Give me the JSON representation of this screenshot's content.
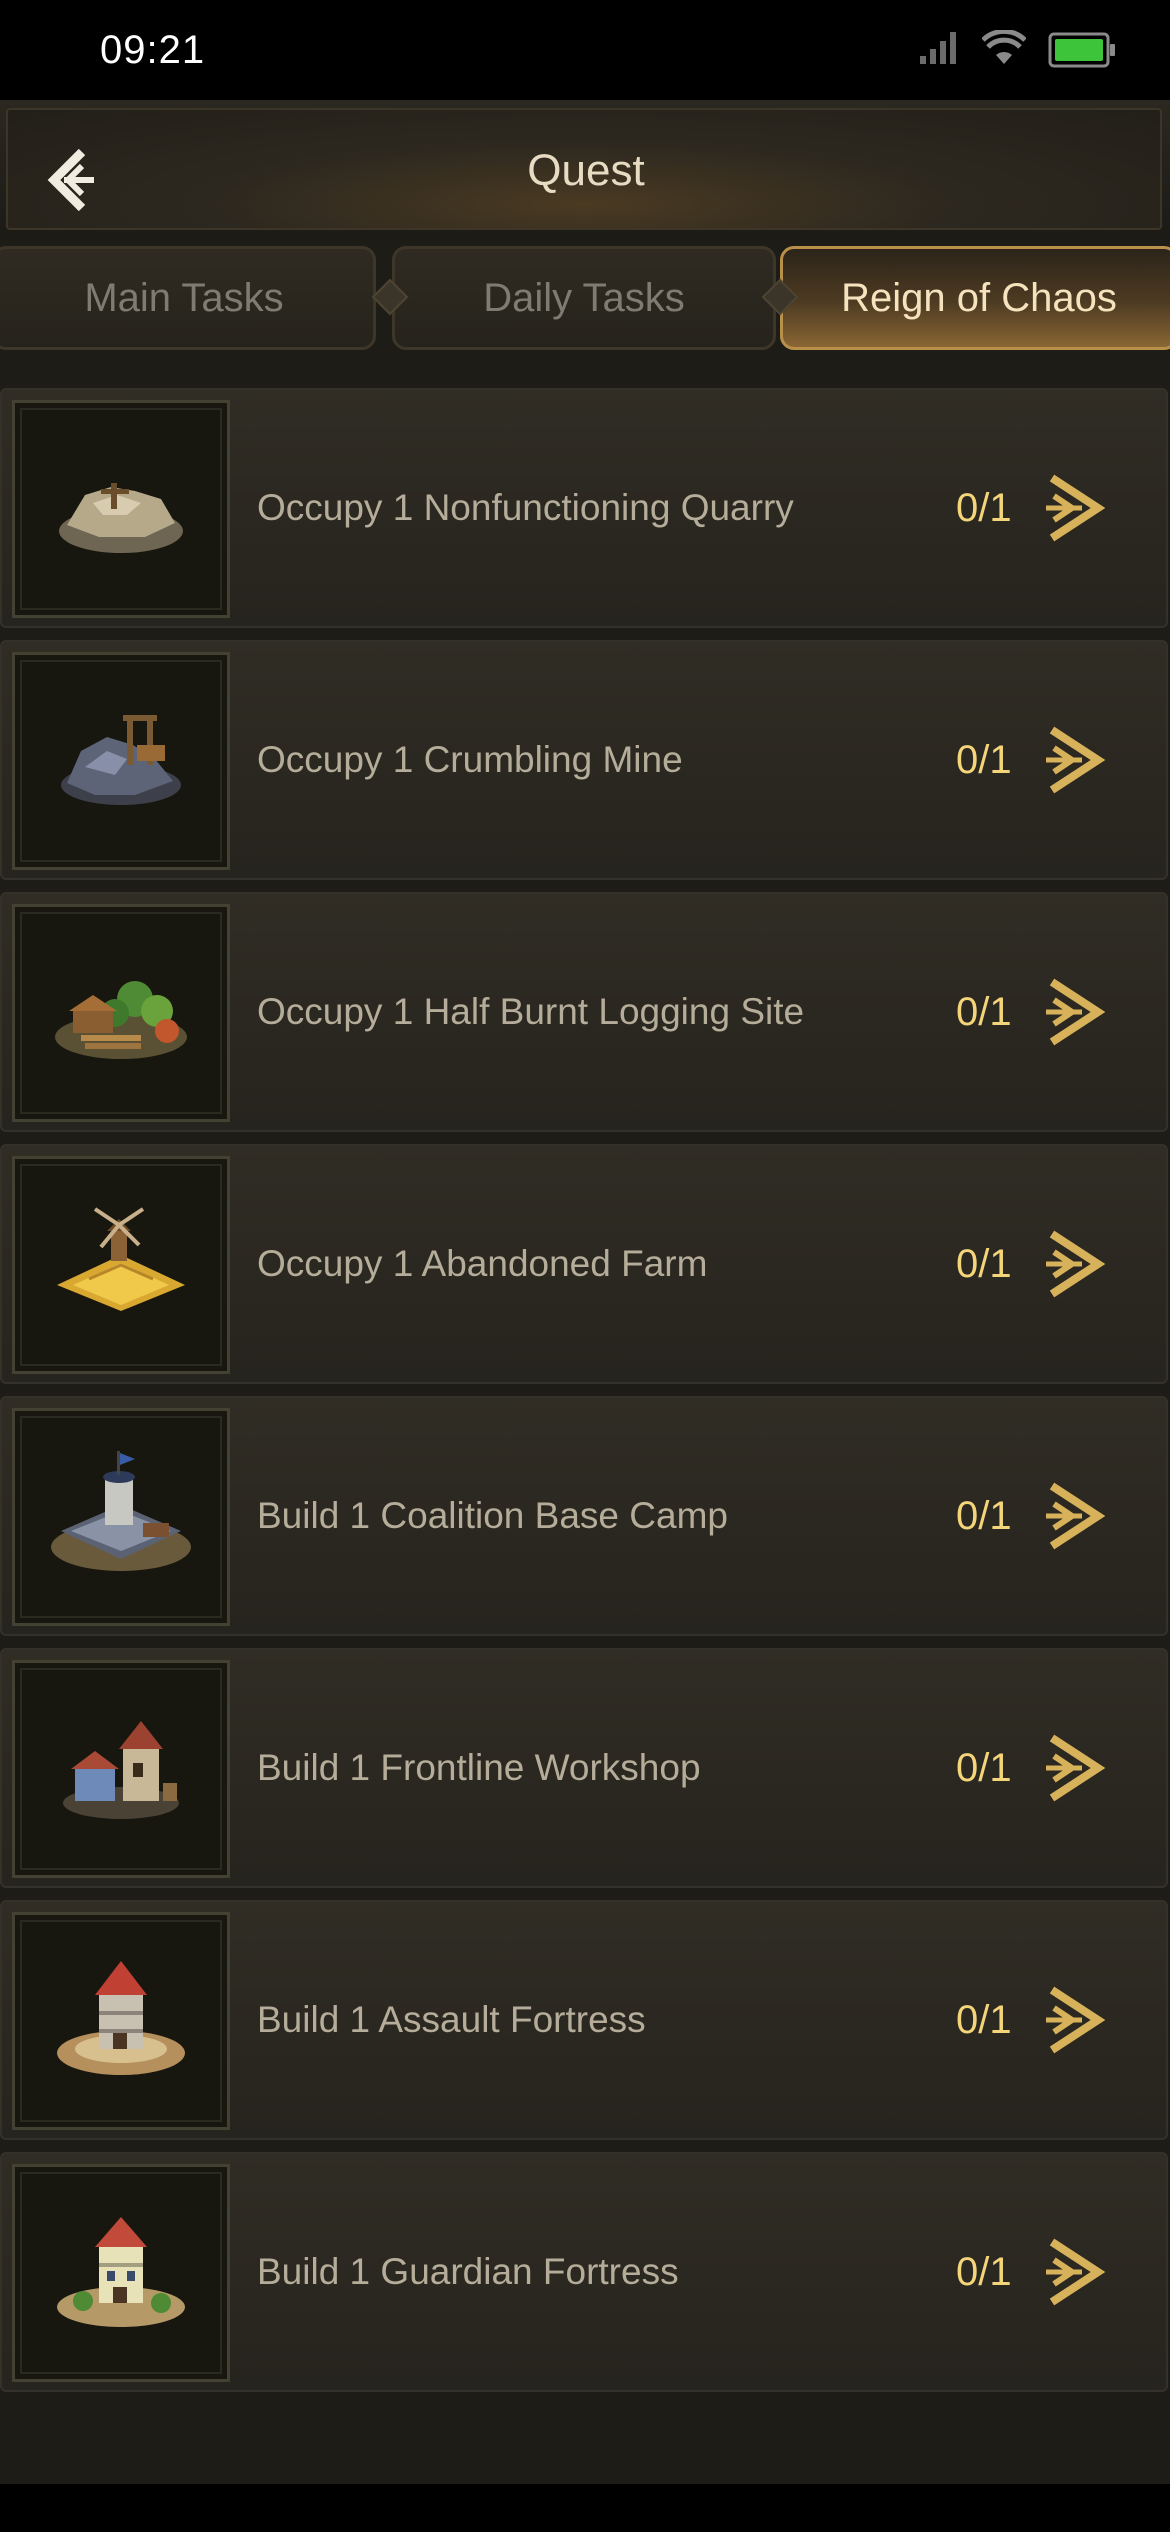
{
  "status_bar": {
    "time": "09:21",
    "icons": [
      "cellular-signal-icon",
      "wifi-icon",
      "battery-icon"
    ],
    "battery_color": "#3ec43a"
  },
  "header": {
    "title": "Quest",
    "back_icon": "back-arrow-icon"
  },
  "tabs": [
    {
      "label": "Main Tasks",
      "active": false
    },
    {
      "label": "Daily Tasks",
      "active": false
    },
    {
      "label": "Reign of Chaos",
      "active": true
    }
  ],
  "quests": [
    {
      "label": "Occupy 1 Nonfunctioning Quarry",
      "progress": "0/1",
      "icon": "quarry-icon"
    },
    {
      "label": "Occupy 1 Crumbling Mine",
      "progress": "0/1",
      "icon": "mine-icon"
    },
    {
      "label": "Occupy 1 Half Burnt Logging Site",
      "progress": "0/1",
      "icon": "logging-site-icon"
    },
    {
      "label": "Occupy 1 Abandoned Farm",
      "progress": "0/1",
      "icon": "farm-icon"
    },
    {
      "label": "Build 1 Coalition Base Camp",
      "progress": "0/1",
      "icon": "base-camp-icon"
    },
    {
      "label": "Build 1 Frontline Workshop",
      "progress": "0/1",
      "icon": "workshop-icon"
    },
    {
      "label": "Build 1 Assault Fortress",
      "progress": "0/1",
      "icon": "assault-fortress-icon"
    },
    {
      "label": "Build 1 Guardian Fortress",
      "progress": "0/1",
      "icon": "guardian-fortress-icon"
    }
  ],
  "colors": {
    "accent_gold": "#d8b25a",
    "progress_text": "#f4d579",
    "active_tab_text": "#f6e3be"
  }
}
